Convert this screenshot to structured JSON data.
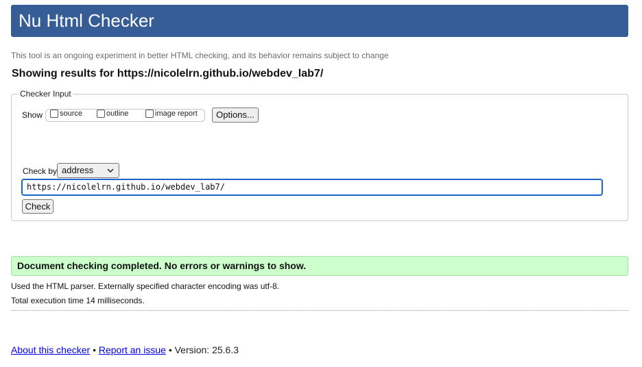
{
  "header": {
    "title": "Nu Html Checker"
  },
  "subtitle": "This tool is an ongoing experiment in better HTML checking, and its behavior remains subject to change",
  "results_title": "Showing results for https://nicolelrn.github.io/webdev_lab7/",
  "checker_input": {
    "legend": "Checker Input",
    "show_label": "Show",
    "checkboxes": [
      {
        "label": "source",
        "checked": false
      },
      {
        "label": "outline",
        "checked": false
      },
      {
        "label": "image report",
        "checked": false
      }
    ],
    "options_button": "Options...",
    "check_by_label": "Check by",
    "check_by_value": "address",
    "url_value": "https://nicolelrn.github.io/webdev_lab7/",
    "check_button": "Check"
  },
  "result": {
    "message": "Document checking completed. No errors or warnings to show.",
    "parser_info": "Used the HTML parser. Externally specified character encoding was utf-8.",
    "execution_time": "Total execution time 14 milliseconds."
  },
  "footer": {
    "about_link": "About this checker",
    "separator": "•",
    "report_link": "Report an issue",
    "version": "Version: 25.6.3"
  },
  "colors": {
    "header_bg": "#365d95",
    "success_bg": "#ccffcc",
    "focus_border": "#1a66c7",
    "link": "#0000ee"
  },
  "icons": {
    "select_chevron": "chevron-down-icon"
  }
}
